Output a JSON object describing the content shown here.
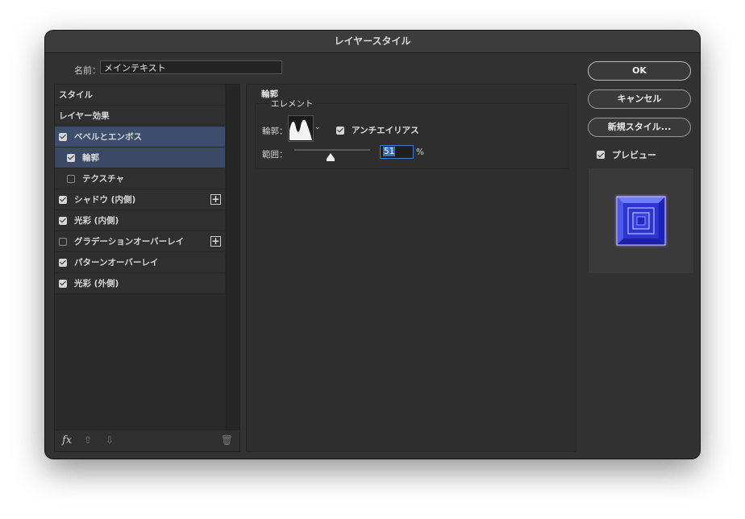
{
  "dialog": {
    "title": "レイヤースタイル"
  },
  "name_field": {
    "label": "名前：",
    "value": "メインテキスト"
  },
  "styles_list": {
    "items": [
      {
        "label": "スタイル",
        "checkbox": null,
        "state": "normal",
        "indent": false,
        "plus": false
      },
      {
        "label": "レイヤー効果",
        "checkbox": null,
        "state": "normal",
        "indent": false,
        "plus": false
      },
      {
        "label": "ベベルとエンボス",
        "checkbox": true,
        "state": "selected",
        "indent": false,
        "plus": false
      },
      {
        "label": "輪郭",
        "checkbox": true,
        "state": "child-selected",
        "indent": true,
        "plus": false
      },
      {
        "label": "テクスチャ",
        "checkbox": false,
        "state": "normal",
        "indent": true,
        "plus": false
      },
      {
        "label": "シャドウ (内側)",
        "checkbox": true,
        "state": "normal",
        "indent": false,
        "plus": true
      },
      {
        "label": "光彩 (内側)",
        "checkbox": true,
        "state": "normal",
        "indent": false,
        "plus": false
      },
      {
        "label": "グラデーションオーバーレイ",
        "checkbox": false,
        "state": "normal",
        "indent": false,
        "plus": true
      },
      {
        "label": "パターンオーバーレイ",
        "checkbox": true,
        "state": "normal",
        "indent": false,
        "plus": false
      },
      {
        "label": "光彩 (外側)",
        "checkbox": true,
        "state": "normal",
        "indent": false,
        "plus": false
      }
    ],
    "footer": {
      "fx_label": "fx",
      "up_icon": "arrow-up-icon",
      "down_icon": "arrow-down-icon",
      "trash_icon": "trash-icon"
    }
  },
  "contour_panel": {
    "section_title": "輪郭",
    "group_title": "エレメント",
    "contour_label": "輪郭：",
    "antialias_label": "アンチエイリアス",
    "antialias_checked": true,
    "range_label": "範囲：",
    "range_value": "51",
    "range_unit": "%",
    "range_fraction": 0.51
  },
  "buttons": {
    "ok": "OK",
    "cancel": "キャンセル",
    "new_style": "新規スタイル..."
  },
  "preview": {
    "label": "プレビュー",
    "checked": true
  },
  "colors": {
    "accent": "#3f7ad8",
    "selected_row": "#3c4e6c",
    "background": "#323232"
  }
}
